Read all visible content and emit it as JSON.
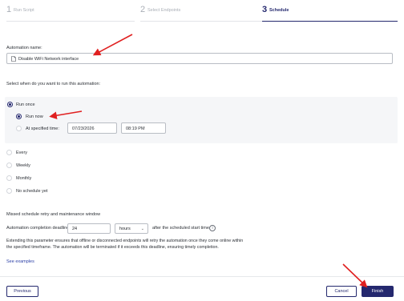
{
  "stepper": {
    "steps": [
      {
        "num": "1",
        "label": "Run Script"
      },
      {
        "num": "2",
        "label": "Select Endpoints"
      },
      {
        "num": "3",
        "label": "Schedule"
      }
    ],
    "active_index": 2
  },
  "automation": {
    "name_label": "Automation name:",
    "name_value": "Disable WiFi Network interface"
  },
  "schedule": {
    "question": "Select when do you want to run this automation:",
    "run_once": "Run once",
    "run_now": "Run now",
    "at_specified_time": "At specified time:",
    "date_value": "07/23/2026",
    "time_value": "08:19 PM",
    "other_options": [
      "Every",
      "Weekly",
      "Monthly",
      "No schedule yet"
    ]
  },
  "retry": {
    "heading": "Missed schedule retry and maintenance window",
    "deadline_label": "Automation completion deadline:",
    "deadline_value": "24",
    "unit_value": "hours",
    "after_text": "after the scheduled start time",
    "info_icon": "info-icon",
    "description": "Extending this parameter ensures that offline or disconnected endpoints will retry the automation once they come online within the specified timeframe. The automation will be terminated if it exceeds this deadline, ensuring timely completion.",
    "see_examples": "See examples"
  },
  "footer": {
    "previous": "Previous",
    "cancel": "Cancel",
    "finish": "Finish"
  },
  "colors": {
    "accent": "#24286e",
    "annotation_arrow": "#e02020",
    "link": "#2b3fa6"
  }
}
